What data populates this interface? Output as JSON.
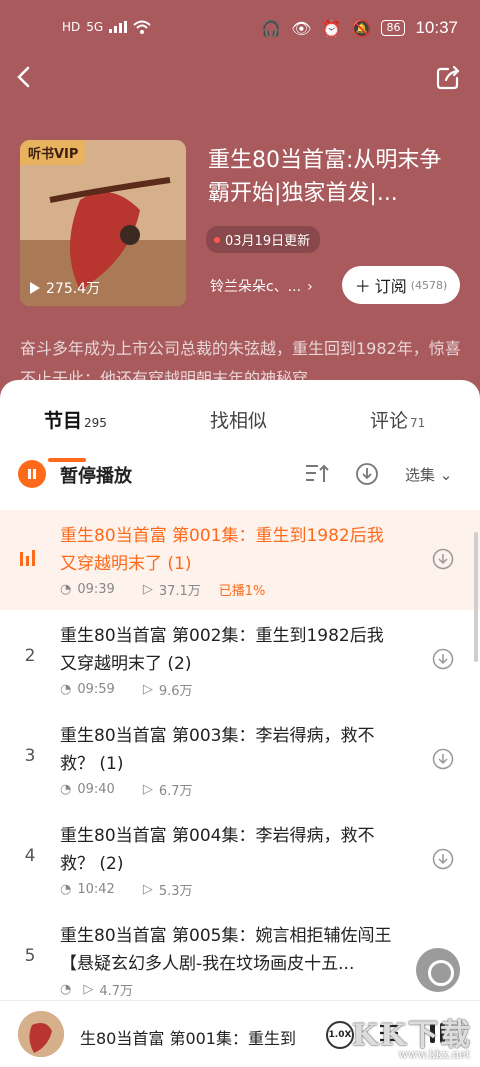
{
  "status_bar": {
    "left_icons": [
      "HD",
      "5G"
    ],
    "battery": "86",
    "time": "10:37"
  },
  "book": {
    "vip_badge": "听书VIP",
    "play_count": "275.4万",
    "title": "重生80当首富:从明末争霸开始|独家首发|...",
    "update": "03月19日更新",
    "author": "铃兰朵朵c、...",
    "subscribe_label": "订阅",
    "subscribe_count": "(4578)",
    "description": "奋斗多年成为上市公司总裁的朱弦越，重生回到1982年，惊喜不止于此：他还有穿越明朝末年的神秘穿..."
  },
  "tabs": [
    {
      "label": "节目",
      "count": "295"
    },
    {
      "label": "找相似",
      "count": ""
    },
    {
      "label": "评论",
      "count": "71"
    }
  ],
  "controls": {
    "pause_label": "暂停播放",
    "select_label": "选集"
  },
  "episodes": [
    {
      "idx": "",
      "title": "重生80当首富  第001集：重生到1982后我又穿越明末了 (1)",
      "duration": "09:39",
      "plays": "37.1万",
      "played": "已播1%"
    },
    {
      "idx": "2",
      "title": "重生80当首富 第002集：重生到1982后我又穿越明末了 (2)",
      "duration": "09:59",
      "plays": "9.6万",
      "played": ""
    },
    {
      "idx": "3",
      "title": "重生80当首富 第003集：李岩得病，救不救？ (1)",
      "duration": "09:40",
      "plays": "6.7万",
      "played": ""
    },
    {
      "idx": "4",
      "title": "重生80当首富 第004集：李岩得病，救不救？ (2)",
      "duration": "10:42",
      "plays": "5.3万",
      "played": ""
    },
    {
      "idx": "5",
      "title": "重生80当首富 第005集：婉言相拒辅佐闯王【悬疑玄幻多人剧-我在坟场画皮十五...",
      "duration": "",
      "plays": "4.7万",
      "played": ""
    }
  ],
  "mini_player": {
    "now_playing": "生80当首富  第001集：重生到",
    "speed": "1.0X"
  },
  "watermark": {
    "text": "KK下载",
    "url": "www.kkx.net"
  },
  "colors": {
    "header_bg": "#a85a5d",
    "accent": "#ff6a1a"
  }
}
